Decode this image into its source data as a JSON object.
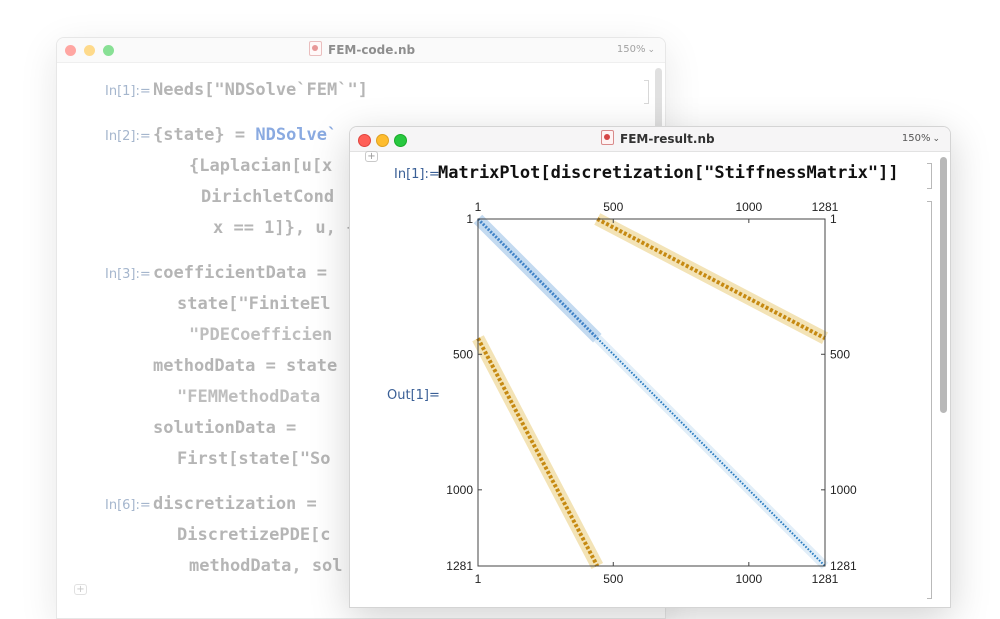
{
  "back_window": {
    "title": "FEM-code.nb",
    "zoom": "150%",
    "cells": {
      "in1_label": "In[1]:=",
      "in1_code": "Needs[\"NDSolve`FEM`\"]",
      "in2_label": "In[2]:=",
      "in2_line1_a": "{state} = ",
      "in2_line1_b": "NDSolve`",
      "in2_line2": "{Laplacian[u[x",
      "in2_line3": "DirichletCond",
      "in2_line4": "x == 1]}, u, {",
      "in3_label": "In[3]:=",
      "in3_line1": "coefficientData =",
      "in3_line2": "state[\"FiniteEl",
      "in3_line3": "\"PDECoefficien",
      "in3_line4": "methodData = state",
      "in3_line5": "\"FEMMethodData",
      "in3_line6": "solutionData =",
      "in3_line7": "First[state[\"So",
      "in6_label": "In[6]:=",
      "in6_line1": "discretization =",
      "in6_line2": "DiscretizePDE[c",
      "in6_line3": "methodData, sol"
    }
  },
  "front_window": {
    "title": "FEM-result.nb",
    "zoom": "150%",
    "in_label": "In[1]:=",
    "in_code": "MatrixPlot[discretization[\"StiffnessMatrix\"]]",
    "out_label": "Out[1]="
  },
  "chart_data": {
    "type": "heatmap",
    "title": "",
    "matrix_size": 1281,
    "x_ticks": [
      1,
      500,
      1000,
      1281
    ],
    "y_ticks": [
      1,
      500,
      1000,
      1281
    ],
    "x_tick_labels": [
      "1",
      "500",
      "1000",
      "1281"
    ],
    "y_tick_labels": [
      "1",
      "500",
      "1000",
      "1281"
    ],
    "xlim": [
      1,
      1281
    ],
    "ylim": [
      1,
      1281
    ],
    "y_direction": "top-to-bottom",
    "bands": [
      {
        "name": "",
        "row_start": 1,
        "row_end": 441,
        "col_start": 1,
        "col_end": 441,
        "color": "#3f82c7",
        "halo": "#c3daf0",
        "kind": "main-diagonal-dense"
      },
      {
        "name": "",
        "row_start": 441,
        "row_end": 1281,
        "col_start": 441,
        "col_end": 1281,
        "color": "#2a7cc0",
        "halo": "#e1eef8",
        "kind": "main-diagonal-sparse"
      },
      {
        "name": "",
        "row_start": 1,
        "row_end": 441,
        "col_start": 441,
        "col_end": 1281,
        "color": "#c68a12",
        "halo": "#f3e3b6",
        "kind": "upper-coupling"
      },
      {
        "name": "",
        "row_start": 441,
        "row_end": 1281,
        "col_start": 1,
        "col_end": 441,
        "color": "#c68a12",
        "halo": "#f3e3b6",
        "kind": "lower-coupling"
      }
    ],
    "colors": {
      "frame": "#444444",
      "background": "#ffffff"
    }
  }
}
